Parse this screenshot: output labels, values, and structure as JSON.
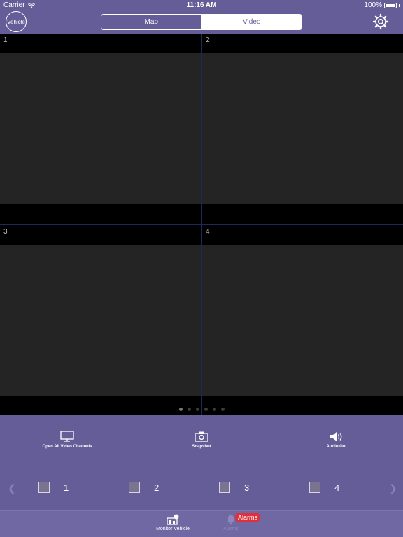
{
  "status_bar": {
    "carrier": "Carrier",
    "time": "11:16 AM",
    "battery": "100%"
  },
  "header": {
    "vehicle_button": "Vehicle",
    "segments": [
      {
        "label": "Map",
        "selected": false
      },
      {
        "label": "Video",
        "selected": true
      }
    ]
  },
  "video_grid": {
    "channels": [
      {
        "number": "1"
      },
      {
        "number": "2"
      },
      {
        "number": "3"
      },
      {
        "number": "4"
      }
    ],
    "page_count": 6,
    "current_page": 1
  },
  "controls": {
    "open_all": "Open All Video Channels",
    "snapshot": "Snapshot",
    "audio": "Audio On",
    "prev_icon": "chevron-left-icon",
    "next_icon": "chevron-right-icon",
    "channel_checks": [
      {
        "label": "1"
      },
      {
        "label": "2"
      },
      {
        "label": "3"
      },
      {
        "label": "4"
      }
    ]
  },
  "tabbar": {
    "monitor": "Monitor Vehicle",
    "alarms": "Alarms",
    "alarms_badge": "Alarms"
  },
  "colors": {
    "header_bg": "#655d98",
    "tabbar_bg": "#7068a3",
    "badge": "#e0303c",
    "video_bg": "#242424"
  }
}
